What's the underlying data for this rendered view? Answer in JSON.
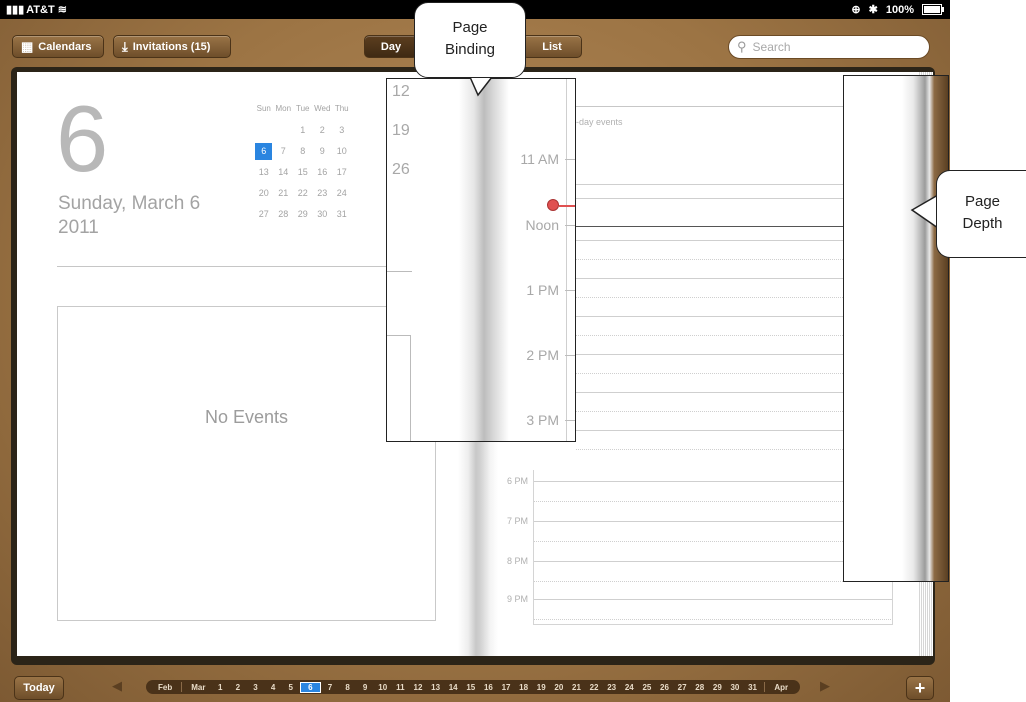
{
  "status": {
    "carrier": "AT&T",
    "battery": "100%"
  },
  "toolbar": {
    "calendars": "Calendars",
    "invitations": "Invitations (15)",
    "tabs": [
      "Day",
      "List"
    ],
    "search_placeholder": "Search"
  },
  "left_page": {
    "big_day": "6",
    "date_line": "Sunday, March 6",
    "year": "2011",
    "weekdays": [
      "Sun",
      "Mon",
      "Tue",
      "Wed",
      "Thu"
    ],
    "weeks": [
      [
        "",
        "",
        "1",
        "2",
        "3"
      ],
      [
        "6",
        "7",
        "8",
        "9",
        "10"
      ],
      [
        "13",
        "14",
        "15",
        "16",
        "17"
      ],
      [
        "20",
        "21",
        "22",
        "23",
        "24"
      ],
      [
        "27",
        "28",
        "29",
        "30",
        "31"
      ]
    ],
    "selected_day": "6",
    "no_events": "No Events"
  },
  "right_page": {
    "all_day": "-day events",
    "time_labels": [
      "6 PM",
      "7 PM",
      "8 PM",
      "9 PM"
    ]
  },
  "zoom_callout": {
    "week_numbers": [
      "12",
      "19",
      "26"
    ],
    "times": [
      "11 AM",
      "Noon",
      "1 PM",
      "2 PM",
      "3 PM"
    ]
  },
  "annotations": {
    "page_binding": [
      "Page",
      "Binding"
    ],
    "page_depth": [
      "Page",
      "Depth"
    ]
  },
  "bottom": {
    "today": "Today",
    "prev_month": "Feb",
    "month": "Mar",
    "next_month": "Apr",
    "days": [
      "1",
      "2",
      "3",
      "4",
      "5",
      "6",
      "7",
      "8",
      "9",
      "10",
      "11",
      "12",
      "13",
      "14",
      "15",
      "16",
      "17",
      "18",
      "19",
      "20",
      "21",
      "22",
      "23",
      "24",
      "25",
      "26",
      "27",
      "28",
      "29",
      "30",
      "31"
    ],
    "selected_day": "6",
    "add": "+"
  },
  "colors": {
    "selection_blue": "#2a85e0",
    "leather": "#9c7444",
    "current_time": "#e05050"
  }
}
